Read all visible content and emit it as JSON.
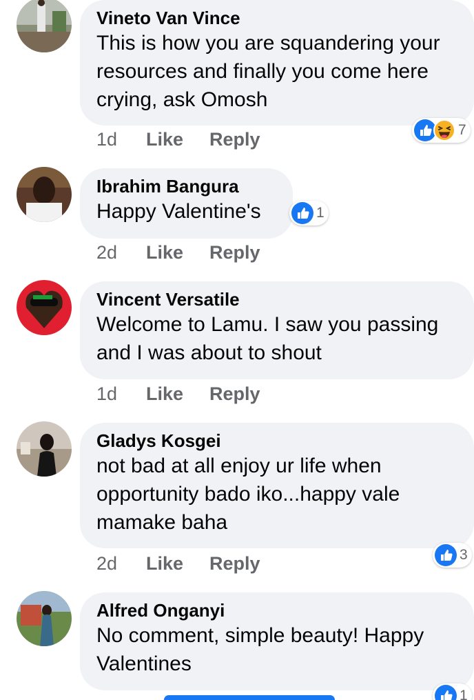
{
  "comments": [
    {
      "author": "Vineto Van Vince",
      "text": "This is how you are squandering your resources and finally you come here crying, ask Omosh",
      "time": "1d",
      "like_label": "Like",
      "reply_label": "Reply",
      "reactions": [
        "like",
        "haha"
      ],
      "reaction_count": "7"
    },
    {
      "author": "Ibrahim Bangura",
      "text": "Happy Valentine's",
      "time": "2d",
      "like_label": "Like",
      "reply_label": "Reply",
      "reactions": [
        "like"
      ],
      "reaction_count": "1"
    },
    {
      "author": "Vincent Versatile",
      "text": "Welcome to Lamu. I saw you passing and I was about to shout",
      "time": "1d",
      "like_label": "Like",
      "reply_label": "Reply",
      "reactions": [],
      "reaction_count": ""
    },
    {
      "author": "Gladys Kosgei",
      "text": "not bad at all enjoy ur life when opportunity bado iko...happy vale mamake baha",
      "time": "2d",
      "like_label": "Like",
      "reply_label": "Reply",
      "reactions": [
        "like"
      ],
      "reaction_count": "3"
    },
    {
      "author": "Alfred Onganyi",
      "text": "No comment, simple beauty! Happy Valentines",
      "time": "",
      "like_label": "",
      "reply_label": "",
      "reactions": [
        "like"
      ],
      "reaction_count": "1"
    }
  ],
  "colors": {
    "bubble": "#f0f2f5",
    "like_blue": "#1877f2",
    "haha_yellow": "#f7b125",
    "meta_gray": "#65676b"
  }
}
